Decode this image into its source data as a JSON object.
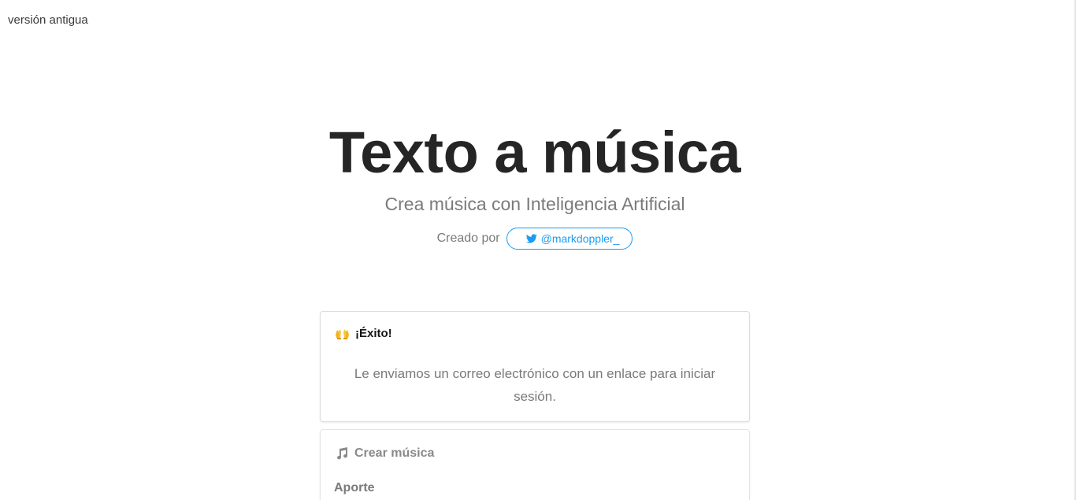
{
  "nav": {
    "old_version_label": "versión antigua"
  },
  "hero": {
    "title": "Texto a música",
    "subtitle": "Crea música con Inteligencia Artificial",
    "credit_label": "Creado por",
    "twitter_handle": "@markdoppler_",
    "twitter_icon": "twitter-bird-icon"
  },
  "success_card": {
    "icon": "raising-hands-icon",
    "title": "¡Éxito!",
    "message": "Le enviamos un correo electrónico con un enlace para iniciar sesión."
  },
  "create_card": {
    "icon": "musical-notes-icon",
    "title": "Crear música",
    "input_label": "Aporte"
  },
  "colors": {
    "accent": "#1d9bf0",
    "title_text": "#252525",
    "muted_text": "#7a7a7a",
    "card_border": "#dcdcdc"
  }
}
